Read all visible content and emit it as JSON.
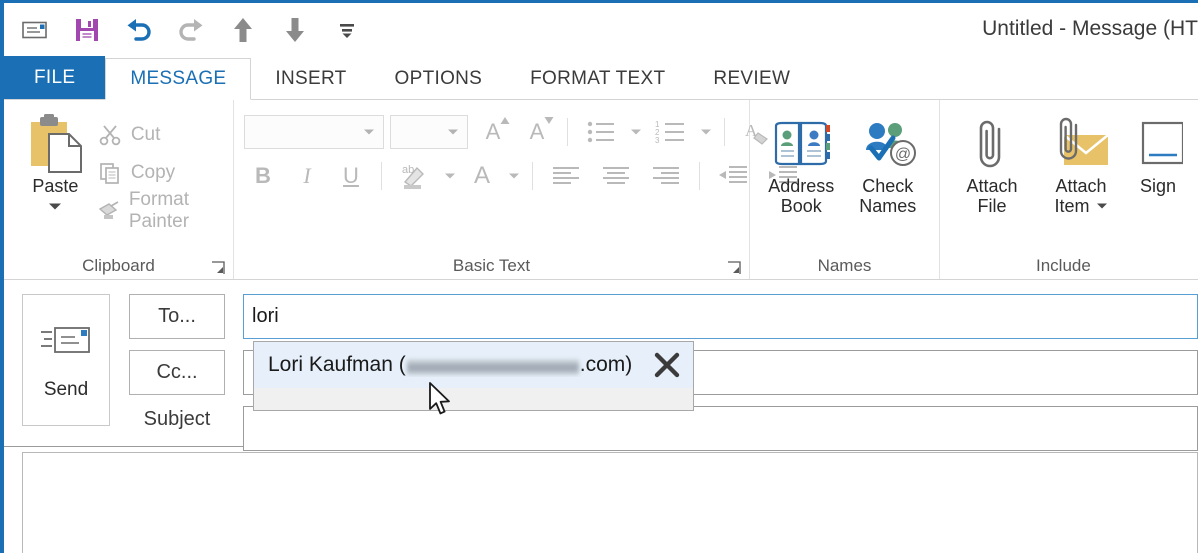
{
  "window": {
    "title": "Untitled - Message (HT"
  },
  "quick_access": [
    {
      "name": "outlook-item-icon",
      "label": "Outlook Item"
    },
    {
      "name": "save-icon",
      "label": "Save"
    },
    {
      "name": "undo-icon",
      "label": "Undo"
    },
    {
      "name": "redo-icon",
      "label": "Redo"
    },
    {
      "name": "previous-item-icon",
      "label": "Previous Item"
    },
    {
      "name": "next-item-icon",
      "label": "Next Item"
    },
    {
      "name": "customize-quick-access-toolbar-icon",
      "label": "Customize Quick Access Toolbar"
    }
  ],
  "tabs": [
    {
      "label": "FILE",
      "state": "file"
    },
    {
      "label": "MESSAGE",
      "state": "active"
    },
    {
      "label": "INSERT",
      "state": "normal"
    },
    {
      "label": "OPTIONS",
      "state": "normal"
    },
    {
      "label": "FORMAT TEXT",
      "state": "normal"
    },
    {
      "label": "REVIEW",
      "state": "normal"
    }
  ],
  "ribbon": {
    "clipboard": {
      "group_label": "Clipboard",
      "paste_label": "Paste",
      "cut_label": "Cut",
      "copy_label": "Copy",
      "format_painter_label": "Format Painter"
    },
    "basic_text": {
      "group_label": "Basic Text",
      "font_name_value": "",
      "font_size_value": "",
      "bold_label": "B",
      "italic_label": "I",
      "underline_label": "U",
      "font_color_label": "A",
      "grow_font_label": "A",
      "shrink_font_label": "A"
    },
    "names": {
      "group_label": "Names",
      "address_book_line1": "Address",
      "address_book_line2": "Book",
      "check_names_line1": "Check",
      "check_names_line2": "Names"
    },
    "include": {
      "group_label": "Include",
      "attach_file_line1": "Attach",
      "attach_file_line2": "File",
      "attach_item_line1": "Attach",
      "attach_item_line2": "Item",
      "signature_label": "Sign"
    }
  },
  "compose": {
    "send_label": "Send",
    "to_button_label": "To...",
    "cc_button_label": "Cc...",
    "subject_label": "Subject",
    "to_value": "lori",
    "cc_value": "",
    "subject_value": "",
    "body_value": ""
  },
  "autocomplete": {
    "contact_name": "Lori Kaufman (",
    "contact_suffix": ".com)",
    "remove_icon_label": "Remove from list"
  },
  "colors": {
    "accent_blue": "#1a6fb5",
    "tab_active_text": "#1a6fb5",
    "suggestion_highlight": "#e7f0fa",
    "save_icon_purple": "#a347b0",
    "paste_gold": "#e8c268"
  }
}
